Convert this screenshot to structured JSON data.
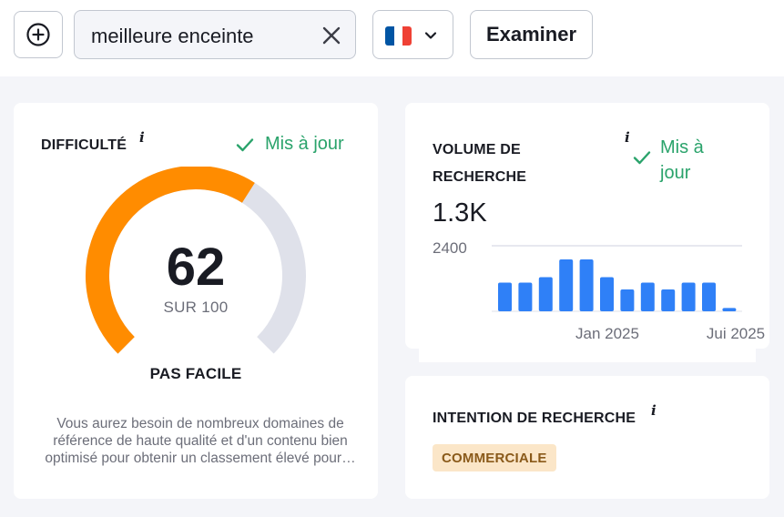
{
  "toolbar": {
    "add_icon": "plus-circle-icon",
    "search": {
      "value": "meilleure enceinte",
      "clear_icon": "close-icon"
    },
    "country": {
      "flag": "france-flag-icon",
      "flag_colors": [
        "#0055a4",
        "#ffffff",
        "#ef4135"
      ],
      "chevron_icon": "chevron-down-icon"
    },
    "examine_label": "Examiner"
  },
  "difficulty": {
    "title": "DIFFICULTÉ",
    "info_label": "i",
    "updated_label": "Mis à jour",
    "score": 62,
    "score_text": "62",
    "score_sub": "SUR 100",
    "label": "PAS FACILE",
    "description": "Vous aurez besoin de nombreux domaines de référence de haute qualité et d'un contenu bien optimisé pour obtenir un classement élevé pour…",
    "colors": {
      "fill": "#ff8c00",
      "track": "#dfe1ea"
    }
  },
  "volume": {
    "title_line1": "VOLUME DE",
    "title_line2": "RECHERCHE",
    "info_label": "i",
    "updated_line1": "Mis à",
    "updated_line2": "jour",
    "value": "1.3K",
    "bar_color": "#2f80f7"
  },
  "intent": {
    "title": "INTENTION DE RECHERCHE",
    "info_label": "i",
    "badge": "COMMERCIALE"
  },
  "colors": {
    "accent_green": "#2aa36b",
    "badge_bg": "#fbe6c8",
    "badge_text": "#8a5a1a"
  },
  "chart_data": {
    "type": "bar",
    "title": "",
    "y_tick_label": "2400",
    "ylim": [
      0,
      2400
    ],
    "x_tick_labels": [
      "Jan 2025",
      "Jui 2025"
    ],
    "categories": [
      "",
      "",
      "",
      "",
      "",
      "",
      "",
      "",
      "",
      "",
      "",
      "",
      ""
    ],
    "values": [
      1050,
      1050,
      1250,
      1900,
      1900,
      1250,
      800,
      1050,
      800,
      1050,
      1050,
      120,
      0
    ],
    "grid": true,
    "legend": "none"
  }
}
